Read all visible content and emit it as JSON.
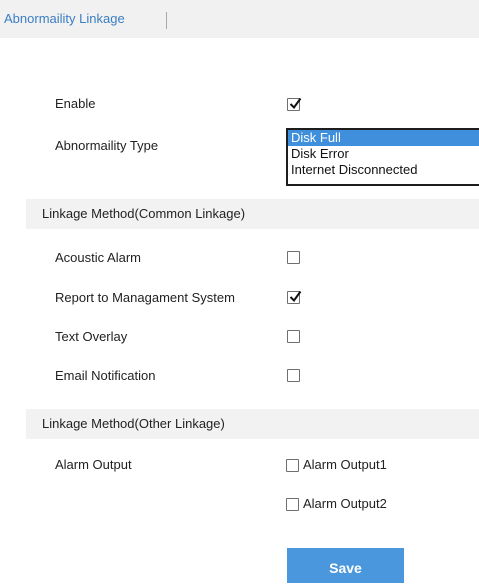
{
  "tabs": [
    {
      "label": "Abnormaility Linkage"
    }
  ],
  "enable": {
    "label": "Enable",
    "checked": true
  },
  "abnormality": {
    "label": "Abnormaility Type",
    "options": [
      "Disk Full",
      "Disk Error",
      "Internet Disconnected"
    ],
    "selected_index": 0
  },
  "common_linkage": {
    "title": "Linkage Method(Common Linkage)",
    "items": [
      {
        "label": "Acoustic Alarm",
        "checked": false
      },
      {
        "label": "Report to Managament System",
        "checked": true
      },
      {
        "label": "Text Overlay",
        "checked": false
      },
      {
        "label": "Email Notification",
        "checked": false
      }
    ]
  },
  "other_linkage": {
    "title": "Linkage Method(Other Linkage)",
    "alarm_output_label": "Alarm Output",
    "outputs": [
      {
        "label": "Alarm Output1",
        "checked": false
      },
      {
        "label": "Alarm Output2",
        "checked": false
      }
    ]
  },
  "save_label": "Save",
  "colors": {
    "accent": "#3a7ec3",
    "button": "#4a97dd",
    "selected": "#3f8fdc"
  }
}
